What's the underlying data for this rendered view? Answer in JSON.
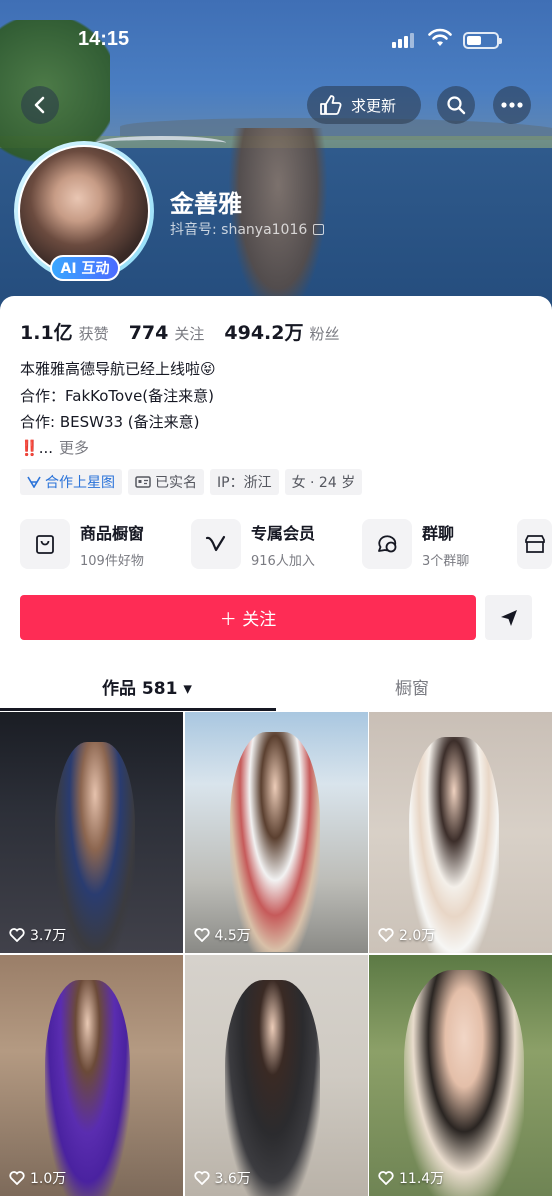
{
  "status_bar": {
    "time": "14:15"
  },
  "header": {
    "update_label": "求更新"
  },
  "profile": {
    "name": "金善雅",
    "id_label": "抖音号: shanya1016",
    "ai_badge": "AI 互动"
  },
  "stats": [
    {
      "value": "1.1亿",
      "label": "获赞"
    },
    {
      "value": "774",
      "label": "关注"
    },
    {
      "value": "494.2万",
      "label": "粉丝"
    }
  ],
  "bio": {
    "line1": "本雅雅高德导航已经上线啦😝",
    "line2": "合作：FakKoTove(备注来意)",
    "line3": "合作: BESW33 (备注来意)",
    "line4_emoji": "‼️",
    "line4_ellipsis": "...",
    "more": "更多"
  },
  "tags": [
    {
      "label": "合作上星图",
      "icon": "star-map-icon",
      "color": "#2a73d9"
    },
    {
      "label": "已实名",
      "icon": "id-card-icon"
    },
    {
      "label": "IP：浙江"
    },
    {
      "label": "女 · 24 岁"
    }
  ],
  "services": [
    {
      "title": "商品橱窗",
      "sub": "109件好物",
      "icon": "bag-icon"
    },
    {
      "title": "专属会员",
      "sub": "916人加入",
      "icon": "vip-v-icon"
    },
    {
      "title": "群聊",
      "sub": "3个群聊",
      "icon": "chat-icon"
    }
  ],
  "actions": {
    "follow": "＋ 关注"
  },
  "tabs": {
    "works": "作品 581 ▾",
    "shop": "橱窗"
  },
  "videos": [
    {
      "likes": "3.7万"
    },
    {
      "likes": "4.5万"
    },
    {
      "likes": "2.0万"
    },
    {
      "likes": "1.0万"
    },
    {
      "likes": "3.6万"
    },
    {
      "likes": "11.4万"
    }
  ],
  "colors": {
    "accent": "#fe2c55",
    "link": "#2a73d9"
  }
}
